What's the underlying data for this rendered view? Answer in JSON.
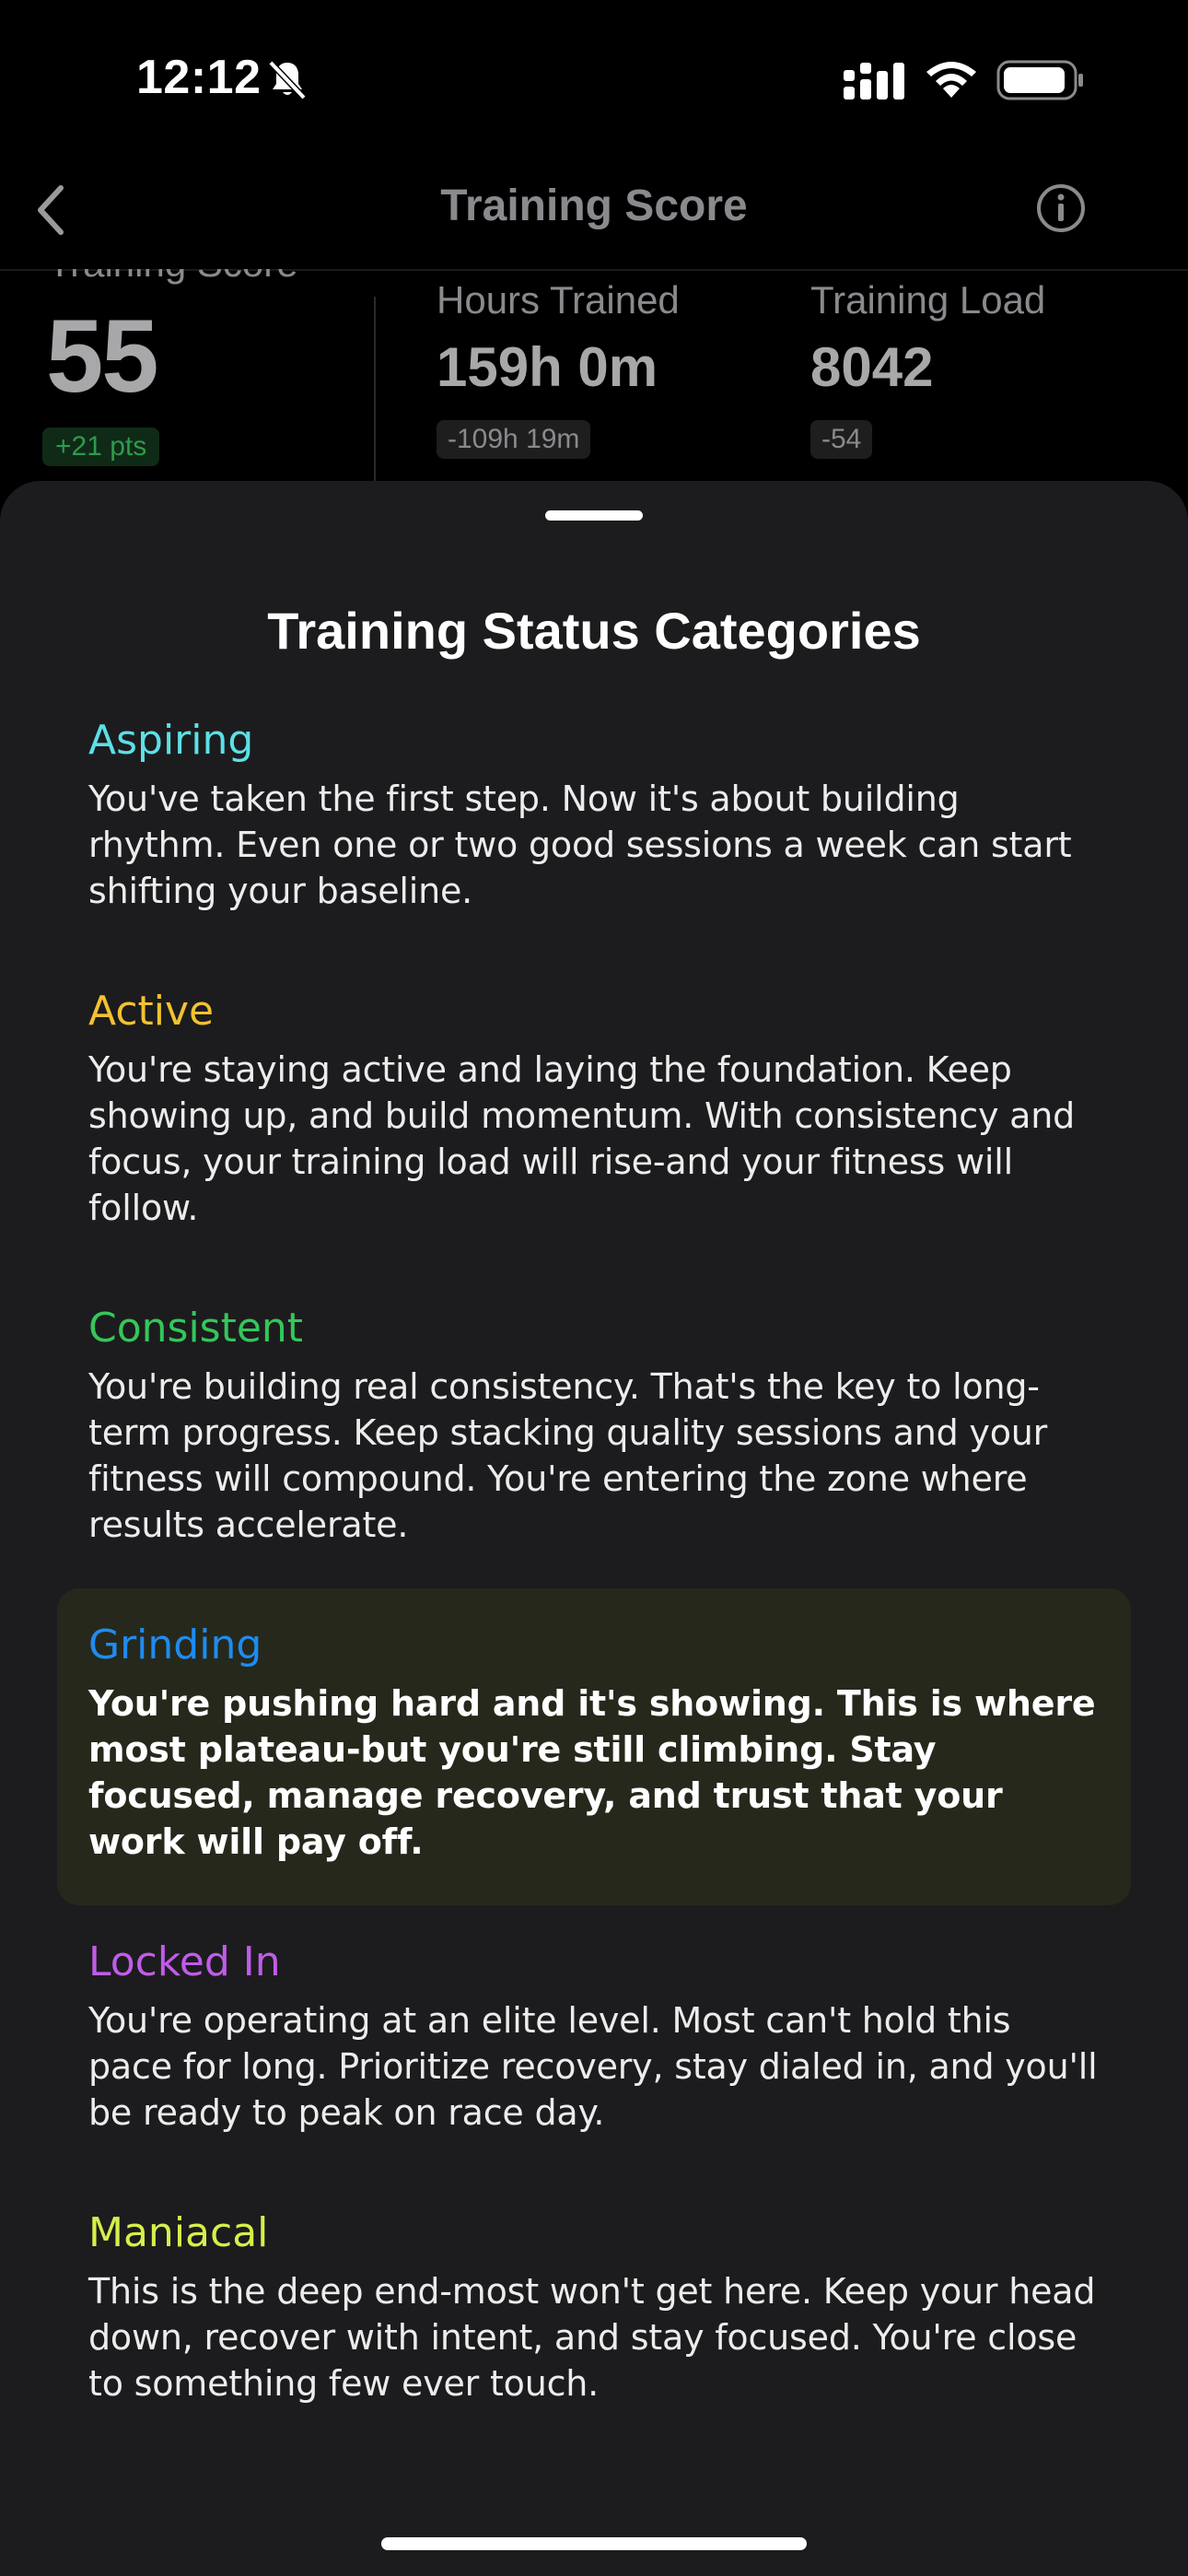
{
  "status_bar": {
    "time": "12:12"
  },
  "nav": {
    "title": "Training Score"
  },
  "stats": {
    "score_label": "Training Score",
    "score_value": "55",
    "score_delta": "+21 pts",
    "hours_label": "Hours Trained",
    "hours_value": "159h 0m",
    "hours_delta": "-109h 19m",
    "load_label": "Training Load",
    "load_value": "8042",
    "load_delta": "-54"
  },
  "sheet": {
    "title": "Training Status Categories",
    "categories": [
      {
        "name": "Aspiring",
        "color": "#5ce0e6",
        "description": "You've taken the first step. Now it's about building rhythm. Even one or two good sessions a week can start shifting your baseline.",
        "highlighted": false
      },
      {
        "name": "Active",
        "color": "#f2c230",
        "description": "You're staying active and laying the foundation. Keep showing up, and build momentum. With consistency and focus, your training load will rise-and your fitness will follow.",
        "highlighted": false
      },
      {
        "name": "Consistent",
        "color": "#34c759",
        "description": "You're building real consistency. That's the key to long-term progress. Keep stacking quality sessions and your fitness will compound. You're entering the zone where results accelerate.",
        "highlighted": false
      },
      {
        "name": "Grinding",
        "color": "#1e8cf0",
        "description": "You're pushing hard and it's showing. This is where most plateau-but you're still climbing. Stay focused, manage recovery, and trust that your work will pay off.",
        "highlighted": true
      },
      {
        "name": "Locked In",
        "color": "#c05ce8",
        "description": "You're operating at an elite level. Most can't hold this pace for long. Prioritize recovery, stay dialed in, and you'll be ready to peak on race day.",
        "highlighted": false
      },
      {
        "name": "Maniacal",
        "color": "#d8ee4a",
        "description": "This is the deep end-most won't get here. Keep your head down, recover with intent, and stay focused. You're close to something few ever touch.",
        "highlighted": false
      }
    ]
  },
  "icons": {
    "bell": "bell-slash-icon",
    "signal": "cellular-signal-icon",
    "wifi": "wifi-icon",
    "battery": "battery-icon",
    "back": "chevron-left-icon",
    "info": "info-icon"
  }
}
